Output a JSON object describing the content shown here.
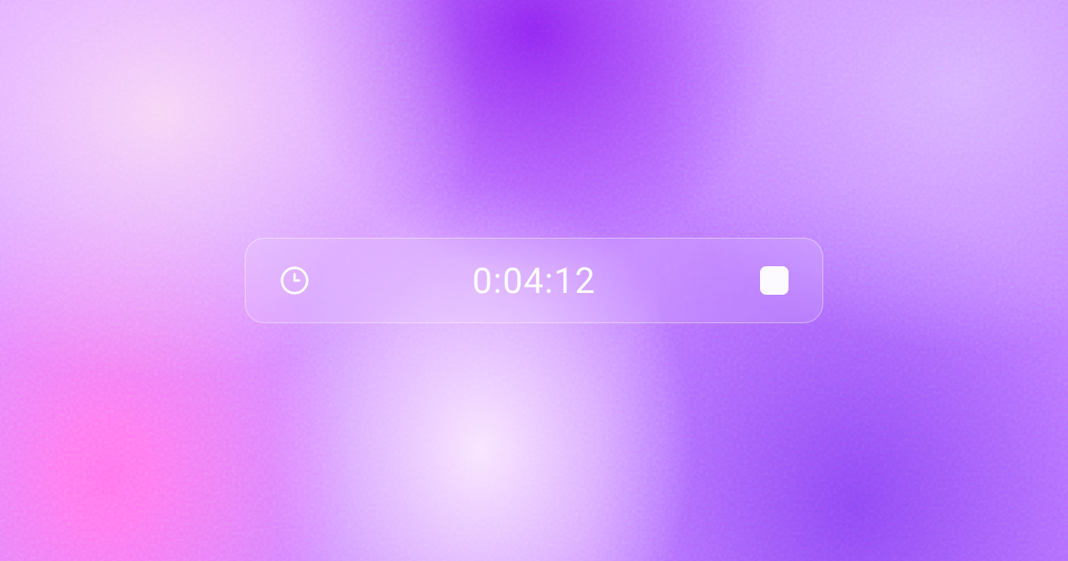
{
  "timer": {
    "elapsed": "0:04:12"
  }
}
